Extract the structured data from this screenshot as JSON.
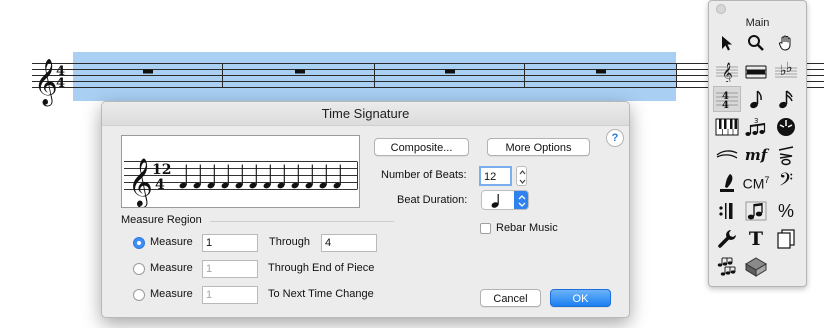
{
  "score": {
    "time_signature": {
      "top": "4",
      "bottom": "4"
    }
  },
  "dialog": {
    "title": "Time Signature",
    "preview": {
      "top": "12",
      "bottom": "4",
      "beats": 12
    },
    "composite_label": "Composite...",
    "more_options_label": "More Options",
    "help_label": "?",
    "number_of_beats_label": "Number of Beats:",
    "number_of_beats_value": "12",
    "beat_duration_label": "Beat Duration:",
    "rebar_music_label": "Rebar Music",
    "measure_region_label": "Measure Region",
    "rows": [
      {
        "radio_label": "Measure",
        "measure_value": "1",
        "suffix": "Through",
        "through_value": "4",
        "selected": true
      },
      {
        "radio_label": "Measure",
        "measure_value": "1",
        "suffix": "Through End of Piece",
        "selected": false
      },
      {
        "radio_label": "Measure",
        "measure_value": "1",
        "suffix": "To Next Time Change",
        "selected": false
      }
    ],
    "cancel_label": "Cancel",
    "ok_label": "OK"
  },
  "palette": {
    "title": "Main",
    "chord_label": "CM",
    "chord_superscript": "7",
    "expression_label": "mf",
    "text_tool_label": "T",
    "percent_label": "%",
    "tools": [
      "selection-arrow-icon",
      "zoom-magnifier-icon",
      "hand-grabber-icon",
      "staff-treble-clef-icon",
      "measure-icon",
      "key-signature-icon",
      "time-signature-icon",
      "simple-entry-note-icon",
      "speedy-entry-note-icon",
      "midi-keyboard-icon",
      "tuplet-icon",
      "smart-shape-icon",
      "hairpin-icon",
      "expression-icon",
      "articulation-icon",
      "lyrics-quill-icon",
      "chord-icon",
      "clef-icon",
      "repeat-icon",
      "mirror-note-icon",
      "percent-icon",
      "wrench-icon",
      "text-icon",
      "graphics-page-icon",
      "note-mover-icon",
      "special-tools-icon"
    ]
  }
}
